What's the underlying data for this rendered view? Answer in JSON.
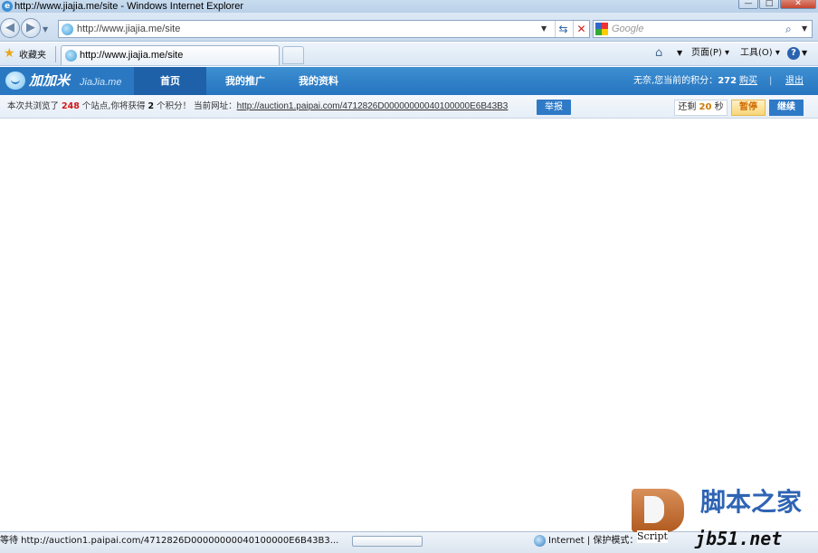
{
  "window": {
    "title": "http://www.jiajia.me/site - Windows Internet Explorer",
    "buttons": [
      "—",
      "□",
      "✕"
    ]
  },
  "address_bar": {
    "url": "http://www.jiajia.me/site",
    "search_placeholder": "Google"
  },
  "favorites_bar": {
    "favorites_label": "收藏夹",
    "tab_label": "http://www.jiajia.me/site",
    "page_menu": "页面(P) ▾",
    "tools_menu": "工具(O) ▾",
    "help_icon": "?"
  },
  "site_nav": {
    "logo_cn": "加加米",
    "logo_en": "JiaJia.me",
    "items": [
      "首页",
      "我的推广",
      "我的资料"
    ],
    "points_prefix": "无奈,您当前的积分：",
    "points_value": "272",
    "buy_label": "购买",
    "divider": "|",
    "logout_label": "退出"
  },
  "info_bar": {
    "text_1": "本次共浏览了",
    "sites_count": "248",
    "text_2": "个站点,你将获得",
    "points_earn": "2",
    "text_3": "个积分！  当前网址：",
    "current_url": "http://auction1.paipai.com/4712826D00000000040100000E6B43B3",
    "report_label": "举报",
    "countdown_prefix": "还剩",
    "countdown_value": "20",
    "countdown_unit": "秒",
    "pause_label": "暂停",
    "continue_label": "继续"
  },
  "status_bar": {
    "status_text": "等待 http://auction1.paipai.com/4712826D00000000040100000E6B43B3...",
    "zone_text": "Internet | 保护模式：",
    "progress": 0
  },
  "watermark": {
    "script_label": "Script",
    "site_name": "脚本之家",
    "domain": "jb51.net"
  },
  "colors": {
    "nav_blue": "#2674bf",
    "nav_active": "#1e61a9",
    "points_red": "#d01818",
    "pause_orange": "#f7d67a",
    "watermark_blue": "#2f64b4"
  }
}
